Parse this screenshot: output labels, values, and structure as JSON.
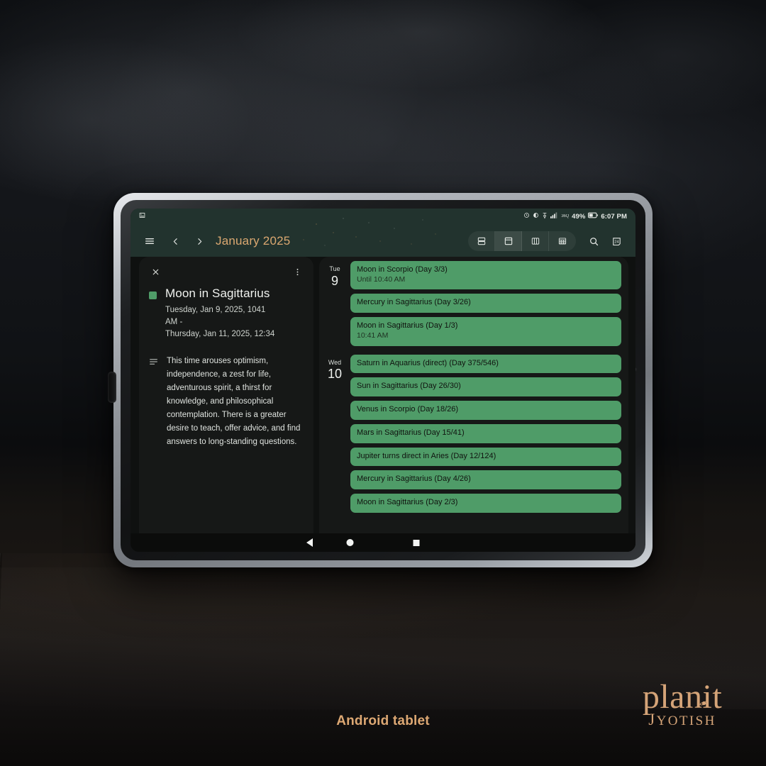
{
  "scene": {
    "caption": "Android tablet",
    "device_label": "Android tablet"
  },
  "brand": {
    "name": "planit",
    "sub_first": "J",
    "sub_rest": "YOTISH",
    "accent_color": "#d5a478",
    "icon": "saturn-planet-icon"
  },
  "statusbar": {
    "left_icon": "screenshot-image-icon",
    "icons": [
      "alarm-clock-icon",
      "do-not-disturb-icon",
      "vpn-key-icon",
      "signal-bars-icon",
      "network-speed-icon"
    ],
    "network_speed": "36Q",
    "battery_percent": "49%",
    "battery_icon": "battery-icon",
    "clock": "6:07 PM"
  },
  "toolbar": {
    "menu_icon": "hamburger-menu-icon",
    "prev_icon": "chevron-left-icon",
    "next_icon": "chevron-right-icon",
    "month_title": "January 2025",
    "views": [
      {
        "id": "schedule",
        "icon": "schedule-view-icon",
        "active": false
      },
      {
        "id": "day",
        "icon": "day-view-icon",
        "active": true
      },
      {
        "id": "three-day",
        "icon": "three-day-view-icon",
        "active": false
      },
      {
        "id": "month",
        "icon": "month-grid-view-icon",
        "active": false
      }
    ],
    "search_icon": "search-icon",
    "today_icon": "today-calendar-24-icon",
    "today_label": "24",
    "accent_color": "#dba871",
    "header_bg": "#22332e"
  },
  "detail": {
    "close_icon": "close-x-icon",
    "more_icon": "overflow-menu-dots-icon",
    "swatch_color": "#4f9c68",
    "title": "Moon in Sagittarius",
    "when_line_1": "Tuesday, Jan 9, 2025, 1041",
    "when_line_2": "AM -",
    "when_line_3": "Thursday, Jan 11, 2025, 12:34",
    "description_icon": "description-lines-icon",
    "description": "This time arouses optimism, independence, a zest for life, adventurous spirit, a thirst for knowledge, and philosophical contemplation. There is a greater desire to teach, offer advice, and find answers to long-standing questions."
  },
  "agenda": {
    "event_color": "#4f9c68",
    "days": [
      {
        "dow": "Tue",
        "num": "9",
        "events": [
          {
            "title": "Moon in Scorpio (Day 3/3)",
            "sub": "Until 10:40 AM"
          },
          {
            "title": "Mercury in Sagittarius (Day 3/26)",
            "sub": ""
          },
          {
            "title": "Moon in Sagittarius (Day 1/3)",
            "sub": "10:41 AM"
          }
        ]
      },
      {
        "dow": "Wed",
        "num": "10",
        "events": [
          {
            "title": "Saturn in Aquarius (direct) (Day 375/546)",
            "sub": ""
          },
          {
            "title": "Sun in Sagittarius (Day 26/30)",
            "sub": ""
          },
          {
            "title": "Venus in Scorpio (Day 18/26)",
            "sub": ""
          },
          {
            "title": "Mars in Sagittarius (Day 15/41)",
            "sub": ""
          },
          {
            "title": "Jupiter turns direct in Aries (Day 12/124)",
            "sub": ""
          },
          {
            "title": "Mercury in Sagittarius (Day 4/26)",
            "sub": ""
          },
          {
            "title": "Moon in Sagittarius (Day 2/3)",
            "sub": ""
          }
        ]
      }
    ]
  },
  "navbar": {
    "back_icon": "nav-back-triangle-icon",
    "home_icon": "nav-home-circle-icon",
    "recents_icon": "nav-recents-square-icon"
  }
}
